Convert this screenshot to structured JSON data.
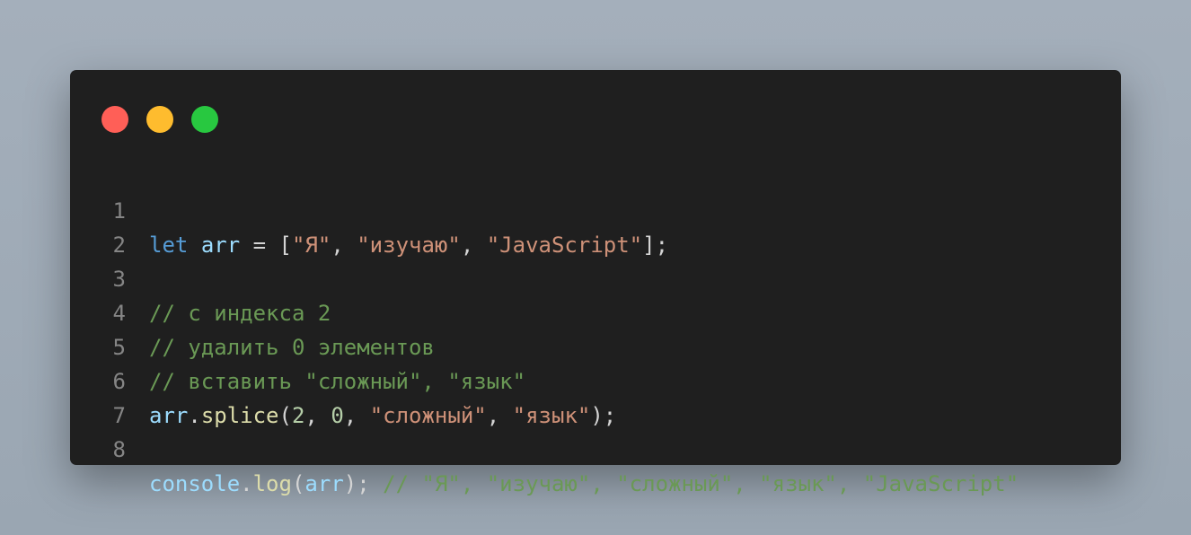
{
  "colors": {
    "background": "#a4afbb",
    "window": "#1f1f1f",
    "line_number": "#858585",
    "keyword": "#569cd6",
    "variable": "#9cdcfe",
    "function": "#dcdcaa",
    "string": "#ce9178",
    "number": "#b5cea8",
    "comment": "#6a9955",
    "punctuation": "#d4d4d4"
  },
  "window_controls": [
    {
      "name": "close-dot",
      "color": "#ff5f57"
    },
    {
      "name": "minimize-dot",
      "color": "#febc2e"
    },
    {
      "name": "maximize-dot",
      "color": "#28c840"
    }
  ],
  "code": {
    "lines": [
      {
        "number": "1",
        "tokens": [
          {
            "text": "let",
            "type": "keyword"
          },
          {
            "text": " ",
            "type": "punctuation"
          },
          {
            "text": "arr",
            "type": "variable"
          },
          {
            "text": " = [",
            "type": "punctuation"
          },
          {
            "text": "\"Я\"",
            "type": "string"
          },
          {
            "text": ", ",
            "type": "punctuation"
          },
          {
            "text": "\"изучаю\"",
            "type": "string"
          },
          {
            "text": ", ",
            "type": "punctuation"
          },
          {
            "text": "\"JavaScript\"",
            "type": "string"
          },
          {
            "text": "];",
            "type": "punctuation"
          }
        ]
      },
      {
        "number": "2",
        "tokens": []
      },
      {
        "number": "3",
        "tokens": [
          {
            "text": "// с индекса 2",
            "type": "comment"
          }
        ]
      },
      {
        "number": "4",
        "tokens": [
          {
            "text": "// удалить 0 элементов",
            "type": "comment"
          }
        ]
      },
      {
        "number": "5",
        "tokens": [
          {
            "text": "// вставить \"сложный\", \"язык\"",
            "type": "comment"
          }
        ]
      },
      {
        "number": "6",
        "tokens": [
          {
            "text": "arr",
            "type": "variable"
          },
          {
            "text": ".",
            "type": "punctuation"
          },
          {
            "text": "splice",
            "type": "function"
          },
          {
            "text": "(",
            "type": "punctuation"
          },
          {
            "text": "2",
            "type": "number"
          },
          {
            "text": ", ",
            "type": "punctuation"
          },
          {
            "text": "0",
            "type": "number"
          },
          {
            "text": ", ",
            "type": "punctuation"
          },
          {
            "text": "\"сложный\"",
            "type": "string"
          },
          {
            "text": ", ",
            "type": "punctuation"
          },
          {
            "text": "\"язык\"",
            "type": "string"
          },
          {
            "text": ");",
            "type": "punctuation"
          }
        ]
      },
      {
        "number": "7",
        "tokens": []
      },
      {
        "number": "8",
        "tokens": [
          {
            "text": "console",
            "type": "variable"
          },
          {
            "text": ".",
            "type": "punctuation"
          },
          {
            "text": "log",
            "type": "function"
          },
          {
            "text": "(",
            "type": "punctuation"
          },
          {
            "text": "arr",
            "type": "variable"
          },
          {
            "text": "); ",
            "type": "punctuation"
          },
          {
            "text": "// \"Я\", \"изучаю\", \"сложный\", \"язык\", \"JavaScript\"",
            "type": "comment"
          }
        ]
      }
    ]
  }
}
